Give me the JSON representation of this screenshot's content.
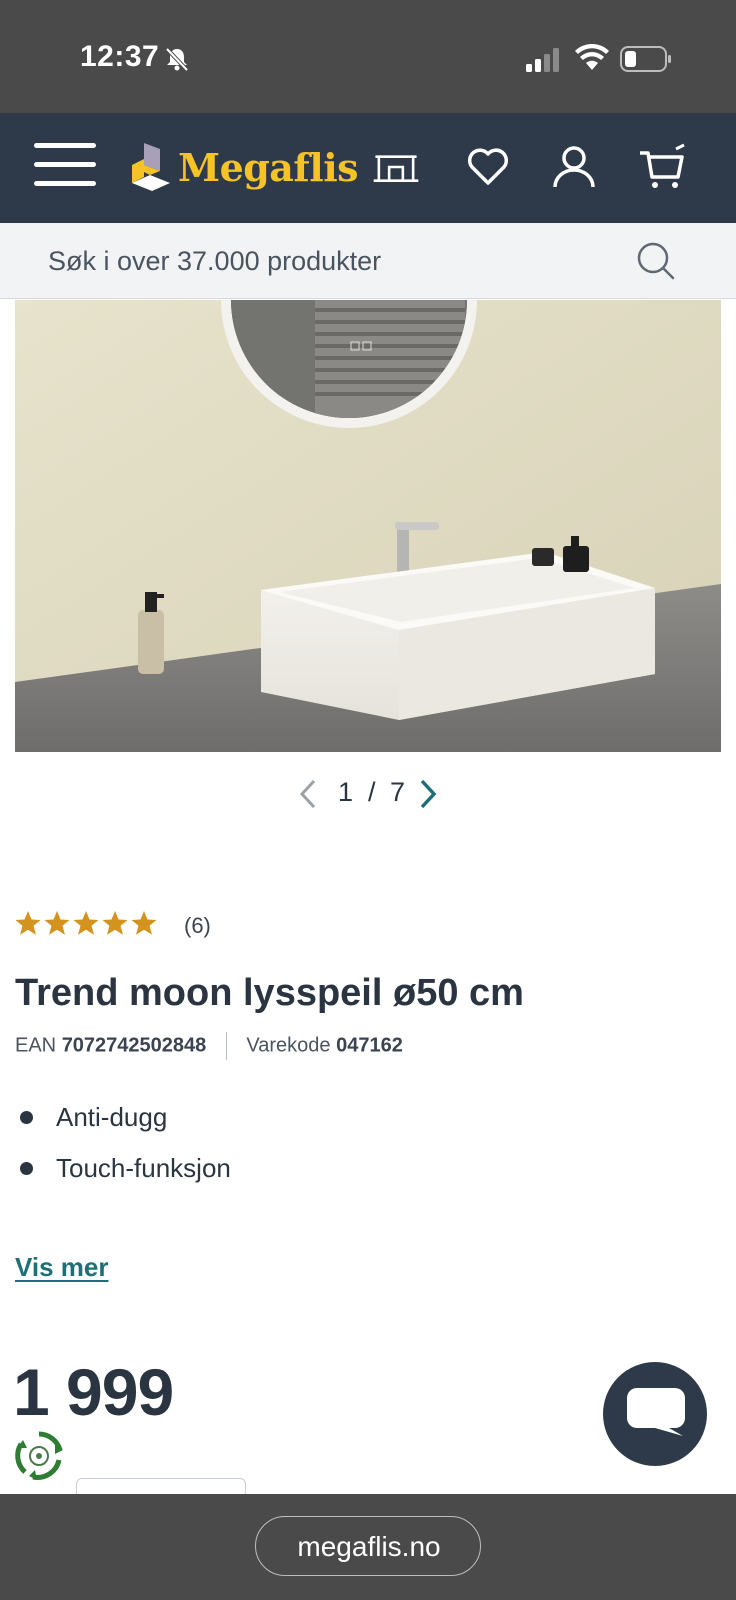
{
  "status_bar": {
    "time": "12:37",
    "icons": [
      "bell-slash-icon",
      "signal-icon",
      "wifi-icon",
      "battery-icon"
    ]
  },
  "header": {
    "logo_text": "Megaflis",
    "brand_color": "#f5c325",
    "background": "#2e3a4a",
    "icons": [
      "menu-icon",
      "store-icon",
      "heart-icon",
      "user-icon",
      "cart-icon"
    ]
  },
  "search": {
    "placeholder": "Søk i over 37.000 produkter"
  },
  "gallery": {
    "current": "1",
    "separator": "/",
    "total": "7"
  },
  "product": {
    "rating_stars": 5,
    "rating_count": "(6)",
    "title": "Trend moon lysspeil ø50 cm",
    "ean_label": "EAN",
    "ean_value": "7072742502848",
    "sku_label": "Varekode",
    "sku_value": "047162",
    "features": [
      "Anti-dugg",
      "Touch-funksjon"
    ],
    "show_more": "Vis mer",
    "price": "1 999"
  },
  "browser": {
    "url": "megaflis.no"
  },
  "colors": {
    "accent_link": "#1e6f78",
    "star": "#d4921e",
    "text": "#2b3542"
  }
}
